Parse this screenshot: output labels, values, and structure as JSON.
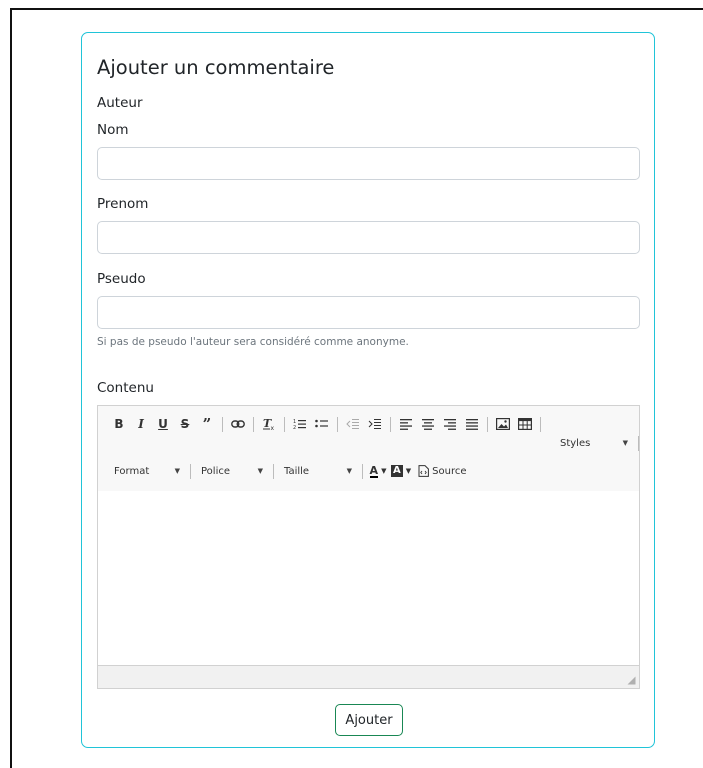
{
  "form": {
    "title": "Ajouter un commentaire",
    "section_label": "Auteur",
    "nom_label": "Nom",
    "nom_value": "",
    "prenom_label": "Prenom",
    "prenom_value": "",
    "pseudo_label": "Pseudo",
    "pseudo_value": "",
    "pseudo_help": "Si pas de pseudo l'auteur sera considéré comme anonyme.",
    "contenu_label": "Contenu",
    "submit_label": "Ajouter"
  },
  "editor": {
    "toolbar_row1": [
      "bold-icon",
      "italic-icon",
      "underline-icon",
      "strikethrough-icon",
      "blockquote-icon",
      "link-icon",
      "remove-format-icon",
      "numbered-list-icon",
      "bulleted-list-icon",
      "outdent-icon",
      "indent-icon",
      "align-left-icon",
      "align-center-icon",
      "align-right-icon",
      "justify-icon",
      "image-icon",
      "table-icon"
    ],
    "styles_label": "Styles",
    "format_label": "Format",
    "font_label": "Police",
    "size_label": "Taille",
    "text_color_label": "A",
    "bg_color_label": "A",
    "source_label": "Source",
    "content": ""
  },
  "colors": {
    "card_border": "#20c4d8",
    "submit_border": "#198754",
    "help_text": "#6c757d"
  }
}
